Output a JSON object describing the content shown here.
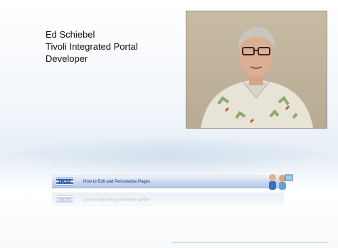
{
  "speaker": {
    "name": "Ed Schiebel",
    "product": "Tivoli Integrated Portal",
    "role": "Developer"
  },
  "banner": {
    "logo": "IBM",
    "title": "How to Edit and Personalize Pages"
  },
  "colors": {
    "banner_blue": "#c9d7ee",
    "logo_blue": "#2d55a8",
    "text_dark": "#111111"
  }
}
